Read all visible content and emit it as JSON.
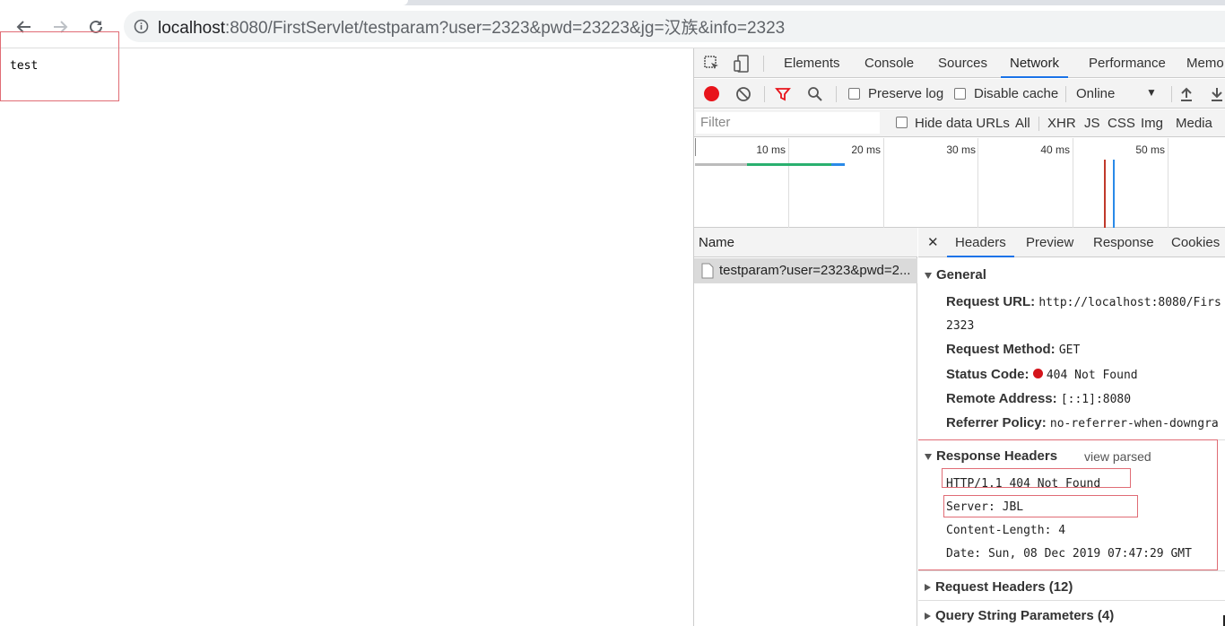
{
  "browser": {
    "url_host": "localhost",
    "url_rest": ":8080/FirstServlet/testparam?user=2323&pwd=23223&jg=汉族&info=2323"
  },
  "page": {
    "text": "test"
  },
  "devtools": {
    "tabs": [
      "Elements",
      "Console",
      "Sources",
      "Network",
      "Performance",
      "Memo"
    ],
    "active_tab": "Network",
    "preserve_log": "Preserve log",
    "disable_cache": "Disable cache",
    "throttle": "Online",
    "filter_placeholder": "Filter",
    "hide_data_urls": "Hide data URLs",
    "filter_types": [
      "All",
      "XHR",
      "JS",
      "CSS",
      "Img",
      "Media"
    ],
    "timeline_ticks": [
      "10 ms",
      "20 ms",
      "30 ms",
      "40 ms",
      "50 ms"
    ],
    "name_header": "Name",
    "request_name": "testparam?user=2323&pwd=2...",
    "detail_tabs": [
      "Headers",
      "Preview",
      "Response",
      "Cookies"
    ],
    "general": {
      "title": "General",
      "request_url_key": "Request URL:",
      "request_url_val": "http://localhost:8080/Firs",
      "request_url_cont": "2323",
      "method_key": "Request Method:",
      "method_val": "GET",
      "status_key": "Status Code:",
      "status_val": "404 Not Found",
      "remote_key": "Remote Address:",
      "remote_val": "[::1]:8080",
      "referrer_key": "Referrer Policy:",
      "referrer_val": "no-referrer-when-downgra"
    },
    "response_headers": {
      "title": "Response Headers",
      "view_parsed": "view parsed",
      "lines": [
        "HTTP/1.1 404 Not Found",
        "Server: JBL",
        "Content-Length: 4",
        "Date: Sun, 08 Dec 2019 07:47:29 GMT"
      ]
    },
    "request_headers": "Request Headers (12)",
    "query_params": "Query String Parameters (4)"
  },
  "colors": {
    "accent": "#1a73e8",
    "record": "#e8141b",
    "annotation": "#e06c75"
  }
}
